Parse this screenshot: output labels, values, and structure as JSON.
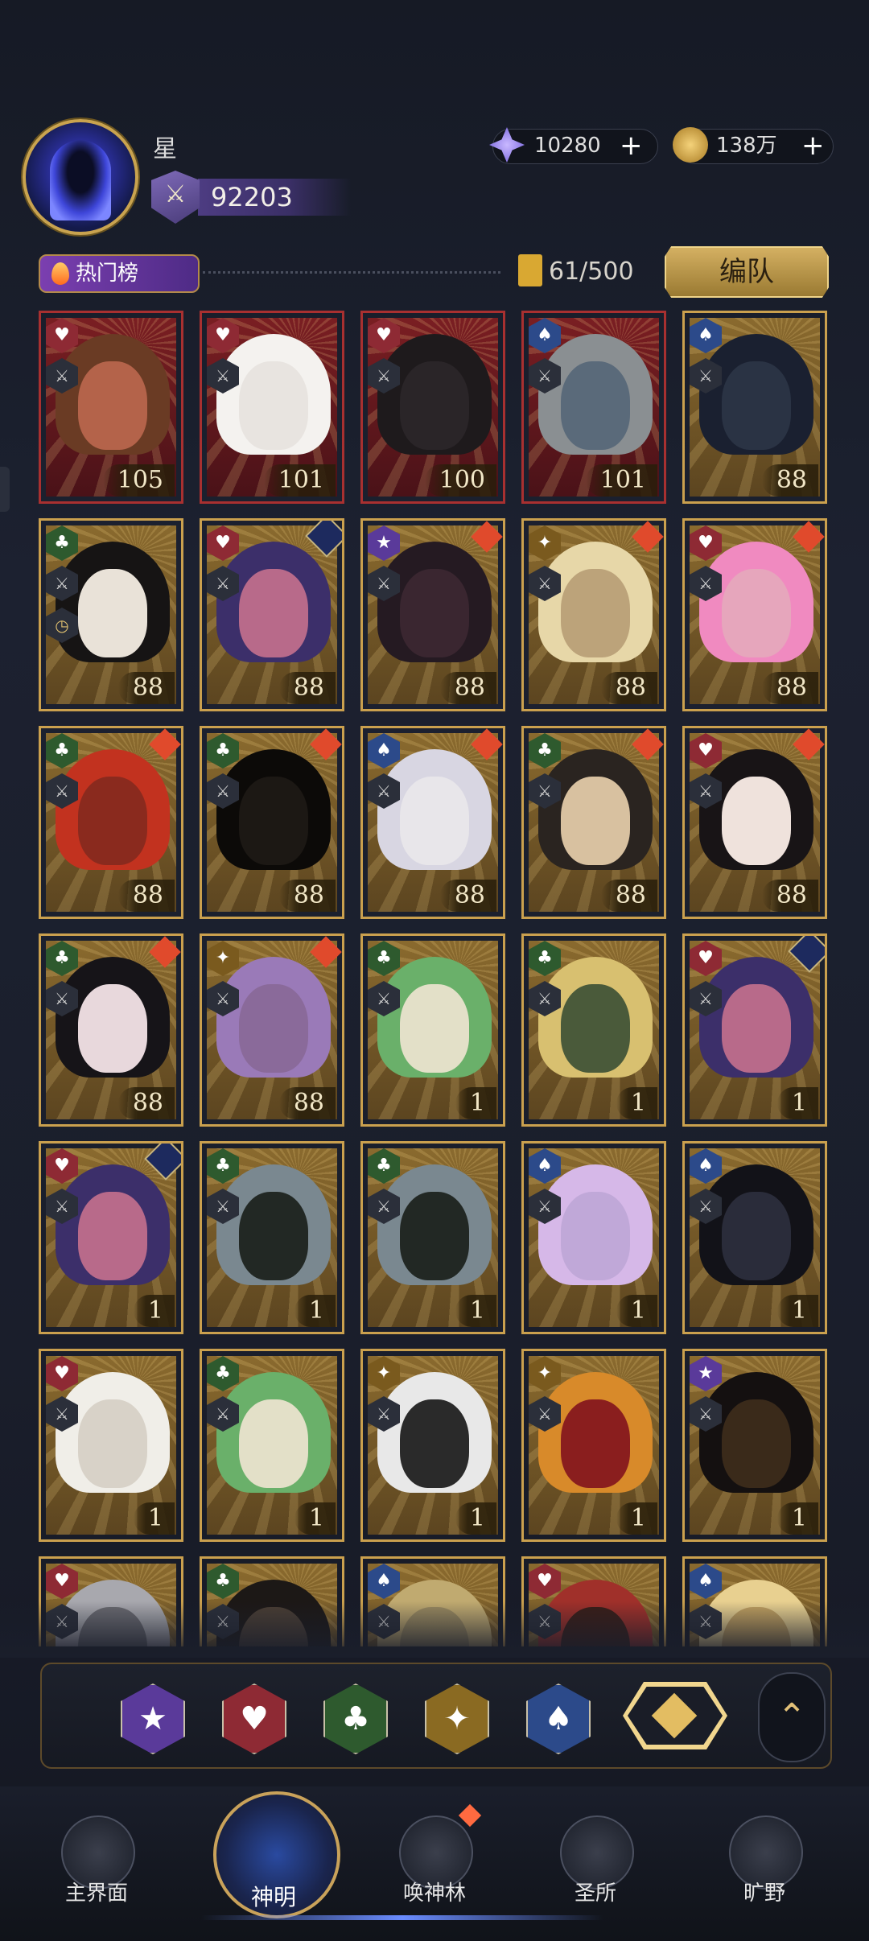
{
  "header": {
    "username": "星",
    "rank_value": "92203",
    "gems": "10280",
    "gold": "138万",
    "plus_symbol": "+"
  },
  "toolbar": {
    "hot_list_label": "热门榜",
    "card_count": "61/500",
    "team_button_label": "编队"
  },
  "cards": [
    {
      "suit": "heart",
      "level": "105",
      "frame": "red",
      "bg": "#b4634a",
      "hair": "#6a3b24",
      "role": "⚔"
    },
    {
      "suit": "heart",
      "level": "101",
      "frame": "red",
      "bg": "#e8e4e0",
      "hair": "#f4f2ef",
      "role": "⚔"
    },
    {
      "suit": "heart",
      "level": "100",
      "frame": "red",
      "bg": "#2a2528",
      "hair": "#1e1a1c",
      "role": "⚔"
    },
    {
      "suit": "spade",
      "level": "101",
      "frame": "red",
      "bg": "#5a6a7a",
      "hair": "#8a8f92",
      "role": "⚔"
    },
    {
      "suit": "spade",
      "level": "88",
      "frame": "gold",
      "bg": "#2a3344",
      "hair": "#1a2030",
      "role": "⚔"
    },
    {
      "suit": "club",
      "level": "88",
      "frame": "gold",
      "bg": "#e9e2d8",
      "hair": "#161414",
      "role": "⚔",
      "clock": true
    },
    {
      "suit": "heart",
      "level": "88",
      "frame": "gold",
      "bg": "#b86a8a",
      "hair": "#3c2f6a",
      "role": "⚔",
      "corner": "blue"
    },
    {
      "suit": "star",
      "level": "88",
      "frame": "gold",
      "bg": "#3a2630",
      "hair": "#251a22",
      "role": "⚔",
      "corner": "red"
    },
    {
      "suit": "diamond",
      "level": "88",
      "frame": "gold",
      "bg": "#bca37a",
      "hair": "#e7d7a8",
      "role": "⚔",
      "corner": "red"
    },
    {
      "suit": "heart",
      "level": "88",
      "frame": "gold",
      "bg": "#e6a6bc",
      "hair": "#f08ac0",
      "role": "⚔",
      "corner": "red"
    },
    {
      "suit": "club",
      "level": "88",
      "frame": "gold",
      "bg": "#8a2a1e",
      "hair": "#c2321f",
      "role": "⚔",
      "corner": "red"
    },
    {
      "suit": "club",
      "level": "88",
      "frame": "gold",
      "bg": "#1c1814",
      "hair": "#0c0a08",
      "role": "⚔",
      "corner": "red"
    },
    {
      "suit": "spade",
      "level": "88",
      "frame": "gold",
      "bg": "#e8e6ea",
      "hair": "#d8d6e2",
      "role": "⚔",
      "corner": "red"
    },
    {
      "suit": "club",
      "level": "88",
      "frame": "gold",
      "bg": "#d8c1a0",
      "hair": "#2a2420",
      "role": "⚔",
      "corner": "red"
    },
    {
      "suit": "heart",
      "level": "88",
      "frame": "gold",
      "bg": "#efe2dc",
      "hair": "#181416",
      "role": "⚔",
      "corner": "red"
    },
    {
      "suit": "club",
      "level": "88",
      "frame": "gold",
      "bg": "#e8d8dc",
      "hair": "#161418",
      "role": "⚔",
      "corner": "red"
    },
    {
      "suit": "diamond",
      "level": "88",
      "frame": "gold",
      "bg": "#8a6a9a",
      "hair": "#9a7ab8",
      "role": "⚔",
      "corner": "red"
    },
    {
      "suit": "club",
      "level": "1",
      "frame": "gold",
      "bg": "#e3e0c8",
      "hair": "#6ab06a",
      "role": "⚔"
    },
    {
      "suit": "club",
      "level": "1",
      "frame": "gold",
      "bg": "#4a5a3a",
      "hair": "#d8c070",
      "role": "⚔"
    },
    {
      "suit": "heart",
      "level": "1",
      "frame": "gold",
      "bg": "#b86a8a",
      "hair": "#3c2f6a",
      "role": "⚔",
      "corner": "blue"
    },
    {
      "suit": "heart",
      "level": "1",
      "frame": "gold",
      "bg": "#b86a8a",
      "hair": "#3c2f6a",
      "role": "⚔",
      "corner": "blue"
    },
    {
      "suit": "club",
      "level": "1",
      "frame": "gold",
      "bg": "#222824",
      "hair": "#7a8890",
      "role": "⚔"
    },
    {
      "suit": "club",
      "level": "1",
      "frame": "gold",
      "bg": "#222824",
      "hair": "#7a8890",
      "role": "⚔"
    },
    {
      "suit": "spade",
      "level": "1",
      "frame": "gold",
      "bg": "#c0a8d8",
      "hair": "#d6b8e8",
      "role": "⚔"
    },
    {
      "suit": "spade",
      "level": "1",
      "frame": "gold",
      "bg": "#2a2c3a",
      "hair": "#121218",
      "role": "⚔"
    },
    {
      "suit": "heart",
      "level": "1",
      "frame": "gold",
      "bg": "#d8d2c8",
      "hair": "#f0eee8",
      "role": "⚔"
    },
    {
      "suit": "club",
      "level": "1",
      "frame": "gold",
      "bg": "#e3e0c8",
      "hair": "#6ab06a",
      "role": "⚔"
    },
    {
      "suit": "diamond",
      "level": "1",
      "frame": "gold",
      "bg": "#2a2a2a",
      "hair": "#e8e8e8",
      "role": "⚔"
    },
    {
      "suit": "diamond",
      "level": "1",
      "frame": "gold",
      "bg": "#8a1e1e",
      "hair": "#d88a2a",
      "role": "⚔"
    },
    {
      "suit": "star",
      "level": "1",
      "frame": "gold",
      "bg": "#3a2a1a",
      "hair": "#141010",
      "role": "⚔"
    },
    {
      "suit": "heart",
      "level": "",
      "frame": "gold",
      "bg": "#6a6a70",
      "hair": "#a8a8ae",
      "role": "⚔"
    },
    {
      "suit": "club",
      "level": "",
      "frame": "gold",
      "bg": "#4a3e34",
      "hair": "#1c1816",
      "role": "⚔"
    },
    {
      "suit": "spade",
      "level": "",
      "frame": "gold",
      "bg": "#9a8a60",
      "hair": "#c0aa70",
      "role": "⚔"
    },
    {
      "suit": "heart",
      "level": "",
      "frame": "gold",
      "bg": "#3a1e18",
      "hair": "#a0302a",
      "role": "⚔"
    },
    {
      "suit": "spade",
      "level": "",
      "frame": "gold",
      "bg": "#c0a060",
      "hair": "#e8d090",
      "role": "⚔"
    }
  ],
  "suit_style": {
    "heart": {
      "color": "#8e2a34",
      "glyph": "♥"
    },
    "spade": {
      "color": "#2c4a8a",
      "glyph": "♠"
    },
    "club": {
      "color": "#2e5a2e",
      "glyph": "♣"
    },
    "diamond": {
      "color": "#7a5a1e",
      "glyph": "✦"
    },
    "star": {
      "color": "#5a3a9a",
      "glyph": "★"
    }
  },
  "filters": [
    {
      "name": "star",
      "glyph": "★",
      "color": "#5a3a9a"
    },
    {
      "name": "heart",
      "glyph": "♥",
      "color": "#8e2a34"
    },
    {
      "name": "club",
      "glyph": "♣",
      "color": "#2e5a2e"
    },
    {
      "name": "diamond",
      "glyph": "✦",
      "color": "#8a6a22"
    },
    {
      "name": "spade",
      "glyph": "♠",
      "color": "#2c4a8a"
    }
  ],
  "nav": [
    {
      "label": "主界面",
      "active": false
    },
    {
      "label": "神明",
      "active": true
    },
    {
      "label": "唤神林",
      "active": false
    },
    {
      "label": "圣所",
      "active": false
    },
    {
      "label": "旷野",
      "active": false
    }
  ]
}
